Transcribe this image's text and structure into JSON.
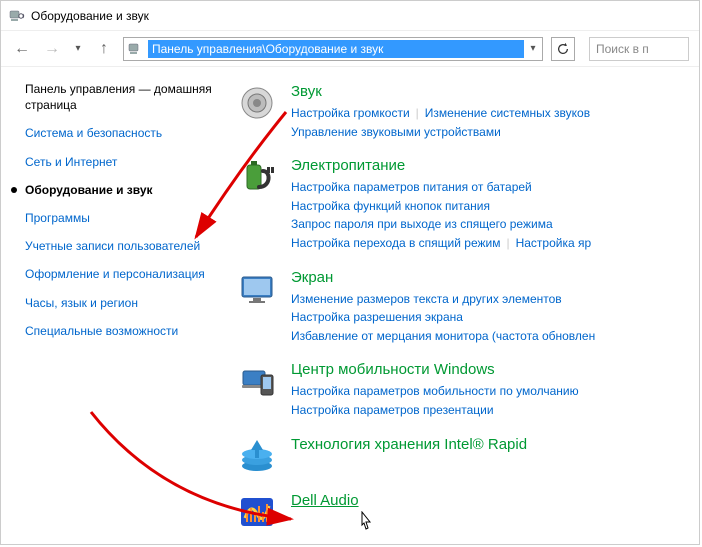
{
  "window": {
    "title": "Оборудование и звук"
  },
  "addressbar": {
    "path": "Панель управления\\Оборудование и звук"
  },
  "search": {
    "placeholder": "Поиск в п"
  },
  "sidebar": {
    "home": "Панель управления — домашняя страница",
    "items": [
      "Система и безопасность",
      "Сеть и Интернет",
      "Оборудование и звук",
      "Программы",
      "Учетные записи пользователей",
      "Оформление и персонализация",
      "Часы, язык и регион",
      "Специальные возможности"
    ],
    "active_index": 2
  },
  "categories": [
    {
      "title": "Звук",
      "links": [
        "Настройка громкости",
        "Изменение системных звуков",
        "Управление звуковыми устройствами"
      ]
    },
    {
      "title": "Электропитание",
      "links": [
        "Настройка параметров питания от батарей",
        "Настройка функций кнопок питания",
        "Запрос пароля при выходе из спящего режима",
        "Настройка перехода в спящий режим",
        "Настройка яр"
      ]
    },
    {
      "title": "Экран",
      "links": [
        "Изменение размеров текста и других элементов",
        "Настройка разрешения экрана",
        "Избавление от мерцания монитора (частота обновлен"
      ]
    },
    {
      "title": "Центр мобильности Windows",
      "links": [
        "Настройка параметров мобильности по умолчанию",
        "Настройка параметров презентации"
      ]
    },
    {
      "title": "Технология хранения Intel® Rapid",
      "links": []
    },
    {
      "title": "Dell Audio",
      "links": [],
      "underline": true
    }
  ]
}
